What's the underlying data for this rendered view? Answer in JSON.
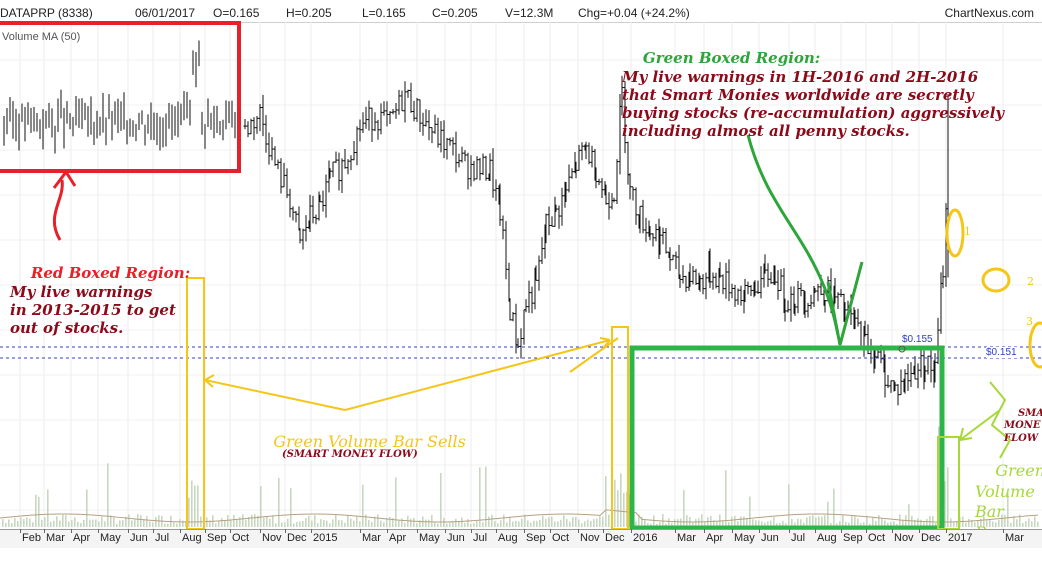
{
  "header": {
    "symbol": "DATAPRP (8338)",
    "date": "06/01/2017",
    "open": "O=0.165",
    "high": "H=0.205",
    "low": "L=0.165",
    "close": "C=0.205",
    "volume": "V=12.3M",
    "change": "Chg=+0.04 (+24.2%)",
    "brand": "ChartNexus.com"
  },
  "volume_panel": {
    "label": "Volume MA (50)"
  },
  "annotations": {
    "green_box_text": "Green Boxed Region:\nMy live warnings in 1H-2016 and 2H-2016\nthat Smart Monies worldwide are secretly\nbuying stocks (re-accumulation) aggressively\nincluding almost all penny stocks.",
    "red_box_text": "Red Boxed Region:\nMy live warnings\nin 2013-2015 to get\nout of stocks.",
    "green_volume_sells": "Green Volume Bar Sells",
    "smart_money_flow": "(SMART MONEY FLOW)",
    "green_volume_buys": "Green\nVolume\nBar\nBuys",
    "smart_money_flow_right": "SMAR\nMONE\nFLOW",
    "marker_1": "1",
    "marker_2": "2",
    "marker_3": "3"
  },
  "price_levels": {
    "level_a": "$0.155",
    "level_b": "$0.151"
  },
  "colors": {
    "red_box": "#e8202a",
    "green_box": "#2db54a",
    "yellow": "#f5c518",
    "lime": "#a6d83a",
    "annotation_red": "#8b0a1a",
    "annotation_green": "#2da53a",
    "annotation_yellow": "#f5c518",
    "dotted_line": "#3040c8"
  },
  "chart_data": {
    "type": "ohlc",
    "x_tick_labels": [
      "Feb",
      "Mar",
      "Apr",
      "May",
      "Jun",
      "Jul",
      "Aug",
      "Sep",
      "Oct",
      "Nov",
      "Dec",
      "2015",
      "Mar",
      "Apr",
      "May",
      "Jun",
      "Jul",
      "Aug",
      "Sep",
      "Oct",
      "Nov",
      "Dec",
      "2016",
      "Mar",
      "Apr",
      "May",
      "Jun",
      "Jul",
      "Aug",
      "Sep",
      "Oct",
      "Nov",
      "Dec",
      "2017",
      "Mar"
    ],
    "ylim": [
      0.08,
      0.27
    ],
    "close_path": [
      {
        "x": 245,
        "c": 0.228
      },
      {
        "x": 260,
        "c": 0.236
      },
      {
        "x": 275,
        "c": 0.212
      },
      {
        "x": 290,
        "c": 0.196
      },
      {
        "x": 300,
        "c": 0.176
      },
      {
        "x": 310,
        "c": 0.188
      },
      {
        "x": 320,
        "c": 0.192
      },
      {
        "x": 330,
        "c": 0.206
      },
      {
        "x": 345,
        "c": 0.214
      },
      {
        "x": 360,
        "c": 0.23
      },
      {
        "x": 375,
        "c": 0.235
      },
      {
        "x": 390,
        "c": 0.231
      },
      {
        "x": 405,
        "c": 0.245
      },
      {
        "x": 420,
        "c": 0.235
      },
      {
        "x": 435,
        "c": 0.226
      },
      {
        "x": 450,
        "c": 0.22
      },
      {
        "x": 465,
        "c": 0.212
      },
      {
        "x": 480,
        "c": 0.21
      },
      {
        "x": 490,
        "c": 0.21
      },
      {
        "x": 500,
        "c": 0.19
      },
      {
        "x": 510,
        "c": 0.145
      },
      {
        "x": 518,
        "c": 0.128
      },
      {
        "x": 526,
        "c": 0.148
      },
      {
        "x": 536,
        "c": 0.156
      },
      {
        "x": 546,
        "c": 0.184
      },
      {
        "x": 556,
        "c": 0.19
      },
      {
        "x": 566,
        "c": 0.2
      },
      {
        "x": 576,
        "c": 0.212
      },
      {
        "x": 586,
        "c": 0.22
      },
      {
        "x": 596,
        "c": 0.21
      },
      {
        "x": 606,
        "c": 0.196
      },
      {
        "x": 614,
        "c": 0.201
      },
      {
        "x": 622,
        "c": 0.245
      },
      {
        "x": 630,
        "c": 0.2
      },
      {
        "x": 640,
        "c": 0.188
      },
      {
        "x": 650,
        "c": 0.182
      },
      {
        "x": 660,
        "c": 0.178
      },
      {
        "x": 670,
        "c": 0.169
      },
      {
        "x": 680,
        "c": 0.16
      },
      {
        "x": 690,
        "c": 0.161
      },
      {
        "x": 700,
        "c": 0.158
      },
      {
        "x": 710,
        "c": 0.162
      },
      {
        "x": 720,
        "c": 0.16
      },
      {
        "x": 735,
        "c": 0.154
      },
      {
        "x": 745,
        "c": 0.151
      },
      {
        "x": 755,
        "c": 0.156
      },
      {
        "x": 765,
        "c": 0.16
      },
      {
        "x": 775,
        "c": 0.162
      },
      {
        "x": 785,
        "c": 0.15
      },
      {
        "x": 795,
        "c": 0.151
      },
      {
        "x": 805,
        "c": 0.15
      },
      {
        "x": 815,
        "c": 0.154
      },
      {
        "x": 825,
        "c": 0.154
      },
      {
        "x": 835,
        "c": 0.15
      },
      {
        "x": 845,
        "c": 0.144
      },
      {
        "x": 855,
        "c": 0.138
      },
      {
        "x": 865,
        "c": 0.13
      },
      {
        "x": 875,
        "c": 0.125
      },
      {
        "x": 885,
        "c": 0.115
      },
      {
        "x": 895,
        "c": 0.108
      },
      {
        "x": 905,
        "c": 0.112
      },
      {
        "x": 915,
        "c": 0.118
      },
      {
        "x": 925,
        "c": 0.12
      },
      {
        "x": 935,
        "c": 0.116
      },
      {
        "x": 943,
        "c": 0.165
      },
      {
        "x": 948,
        "c": 0.205
      }
    ]
  }
}
